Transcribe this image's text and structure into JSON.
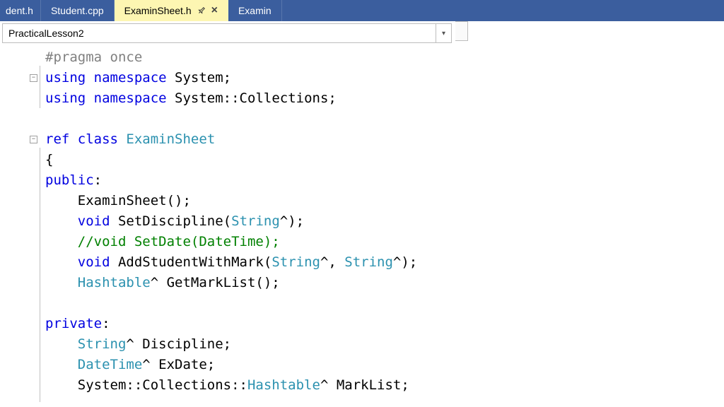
{
  "tabs": [
    {
      "label": "dent.h",
      "active": false,
      "partial": true
    },
    {
      "label": "Student.cpp",
      "active": false,
      "partial": false
    },
    {
      "label": "ExaminSheet.h",
      "active": true,
      "partial": false
    },
    {
      "label": "Examin",
      "active": false,
      "partial": true
    }
  ],
  "navbar": {
    "text": "PracticalLesson2"
  },
  "code": {
    "l1": {
      "pp": "#pragma once"
    },
    "l2": {
      "kw1": "using",
      "kw2": "namespace",
      "t": " System;"
    },
    "l3": {
      "kw1": "using",
      "kw2": "namespace",
      "t": " System::Collections;"
    },
    "l4": {
      "blank": ""
    },
    "l5": {
      "kw1": "ref",
      "kw2": "class",
      "typ": " ExaminSheet"
    },
    "l6": {
      "t": "{"
    },
    "l7": {
      "kw": "public",
      "t": ":"
    },
    "l8": {
      "t": "    ExaminSheet();"
    },
    "l9": {
      "kw": "void",
      "t1": " SetDiscipline(",
      "typ": "String",
      "t2": "^);"
    },
    "l10": {
      "cmt": "    //void SetDate(DateTime);"
    },
    "l11": {
      "kw": "void",
      "t1": " AddStudentWithMark(",
      "typ1": "String",
      "t2": "^, ",
      "typ2": "String",
      "t3": "^);"
    },
    "l12": {
      "typ": "Hashtable",
      "t": "^ GetMarkList();"
    },
    "l13": {
      "blank": ""
    },
    "l14": {
      "kw": "private",
      "t": ":"
    },
    "l15": {
      "typ": "String",
      "t": "^ Discipline;"
    },
    "l16": {
      "typ": "DateTime",
      "t": "^ ExDate;"
    },
    "l17": {
      "t1": "    System::Collections::",
      "typ": "Hashtable",
      "t2": "^ MarkList;"
    }
  },
  "icons": {
    "pin": "⚲",
    "close": "×",
    "caret": "▾",
    "minus": "−"
  }
}
